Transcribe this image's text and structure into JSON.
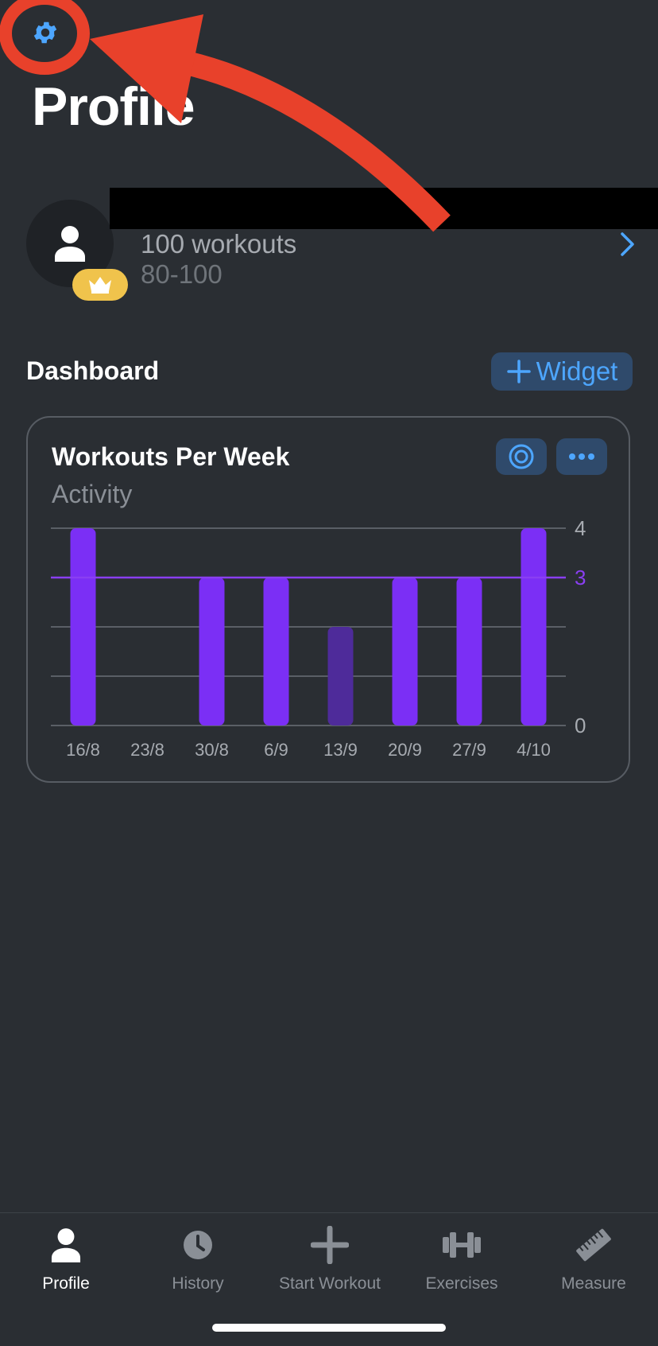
{
  "header": {
    "title": "Profile",
    "settings_icon": "gear-icon"
  },
  "profile": {
    "name_hidden": true,
    "workouts": "100 workouts",
    "level": "80-100",
    "badge_icon": "crown-icon"
  },
  "dashboard": {
    "title": "Dashboard",
    "add_widget_label": "Widget"
  },
  "widget": {
    "title": "Workouts Per Week",
    "subtitle": "Activity"
  },
  "chart_data": {
    "type": "bar",
    "categories": [
      "16/8",
      "23/8",
      "30/8",
      "6/9",
      "13/9",
      "20/9",
      "27/9",
      "4/10"
    ],
    "values": [
      4,
      0,
      3,
      3,
      2,
      3,
      3,
      4
    ],
    "highlight": [
      true,
      true,
      true,
      true,
      false,
      true,
      true,
      true
    ],
    "goal": 3,
    "ylim": [
      0,
      4
    ],
    "yticks_labeled": [
      0,
      3,
      4
    ],
    "gridlines": [
      0,
      1,
      2,
      3,
      4
    ],
    "colors": {
      "bar": "#7b2ff5",
      "bar_dim": "#4e2b9a",
      "goal": "#8a3ff2",
      "grid": "#5a5f66"
    }
  },
  "tabs": [
    {
      "label": "Profile",
      "icon": "person-icon",
      "active": true
    },
    {
      "label": "History",
      "icon": "clock-icon",
      "active": false
    },
    {
      "label": "Start Workout",
      "icon": "plus-icon",
      "active": false
    },
    {
      "label": "Exercises",
      "icon": "dumbbell-icon",
      "active": false
    },
    {
      "label": "Measure",
      "icon": "ruler-icon",
      "active": false
    }
  ],
  "colors": {
    "accent": "#4da6ff",
    "background": "#2a2e33",
    "annotation": "#e8412b"
  }
}
